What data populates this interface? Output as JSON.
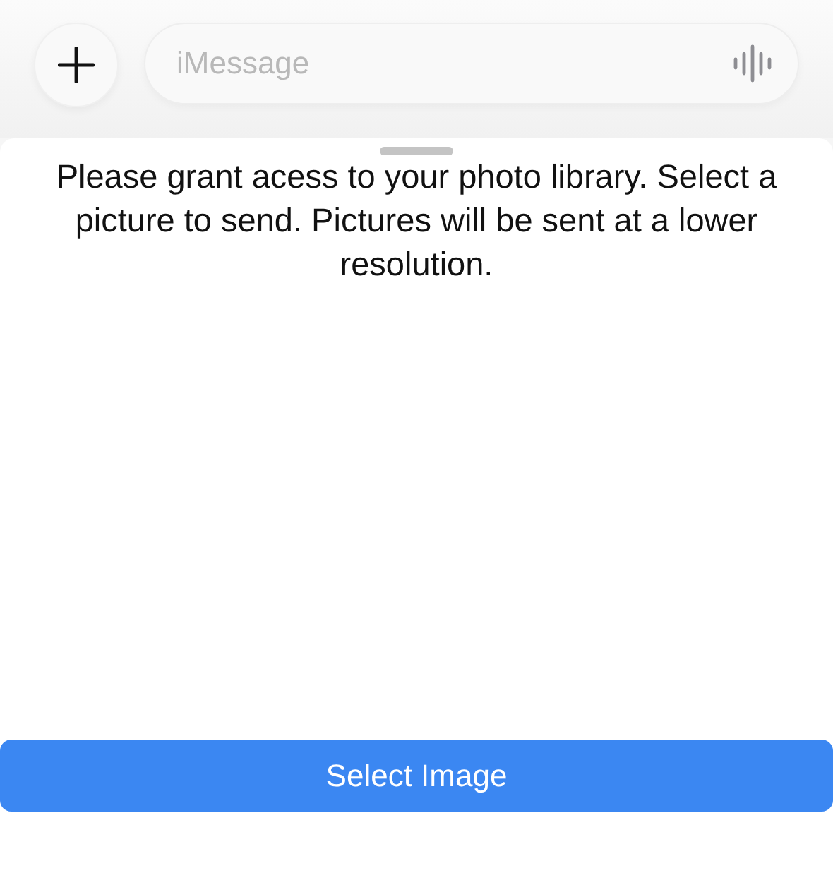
{
  "compose_bar": {
    "message_field": {
      "placeholder": "iMessage"
    }
  },
  "sheet": {
    "message": "Please grant acess to your photo library. Select a picture to send. Pictures will be sent at a lower resolution.",
    "button": "Select Image"
  }
}
